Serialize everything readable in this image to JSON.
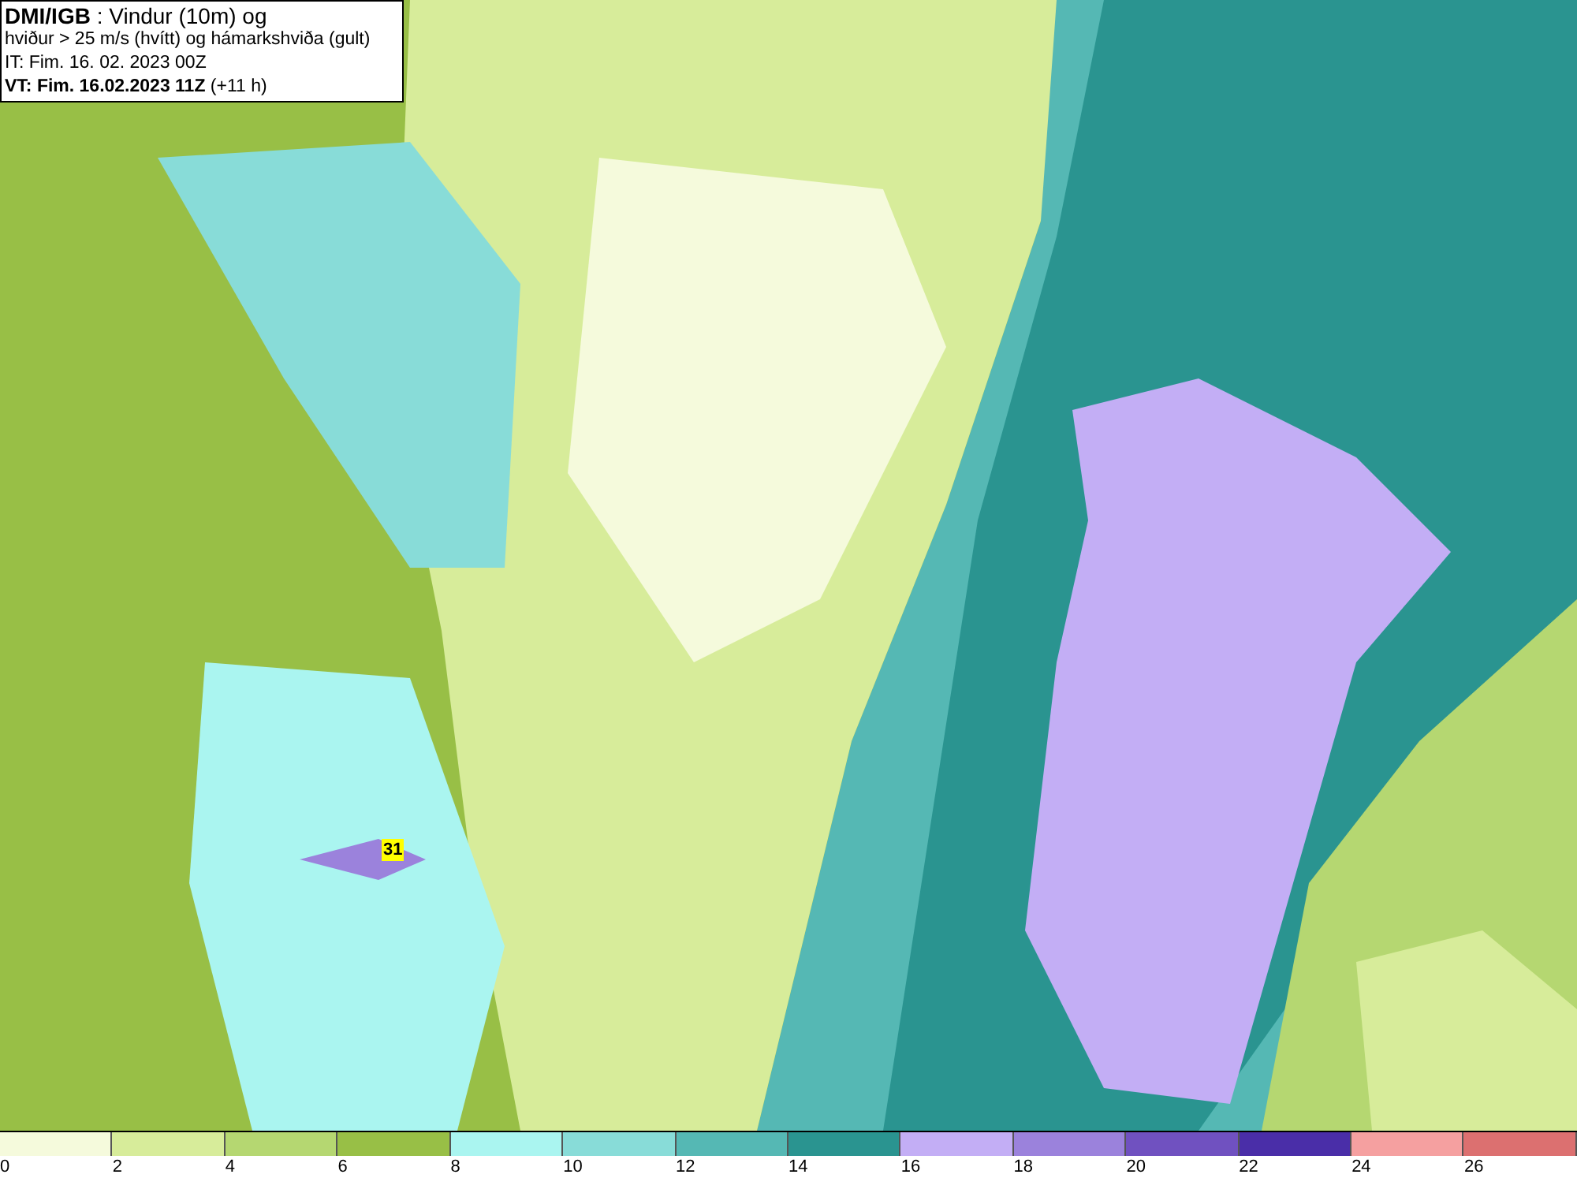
{
  "title_box": {
    "lines": [
      "**DMI/IGB** : Vindur (10m) og",
      "hviður > 25 m/s (hvítt) og hámarkshviða (gult)",
      "IT: Fim. 16. 02. 2023 00Z",
      "**VT: Fim. 16.02.2023 11Z** (+11 h)"
    ]
  },
  "gust_marker": {
    "value": "31"
  },
  "legend": [
    {
      "label": "0",
      "color": "#f5fadc"
    },
    {
      "label": "2",
      "color": "#d7ec9a"
    },
    {
      "label": "4",
      "color": "#b5d771"
    },
    {
      "label": "6",
      "color": "#98bf46"
    },
    {
      "label": "8",
      "color": "#aaf5f0"
    },
    {
      "label": "10",
      "color": "#88dcd8"
    },
    {
      "label": "12",
      "color": "#55b8b4"
    },
    {
      "label": "14",
      "color": "#2a9490"
    },
    {
      "label": "16",
      "color": "#c3aef5"
    },
    {
      "label": "18",
      "color": "#9b82dc"
    },
    {
      "label": "20",
      "color": "#7051c0"
    },
    {
      "label": "22",
      "color": "#4a2ea8"
    },
    {
      "label": "24",
      "color": "#f5a0a0"
    },
    {
      "label": "26",
      "color": "#dc7070"
    }
  ]
}
